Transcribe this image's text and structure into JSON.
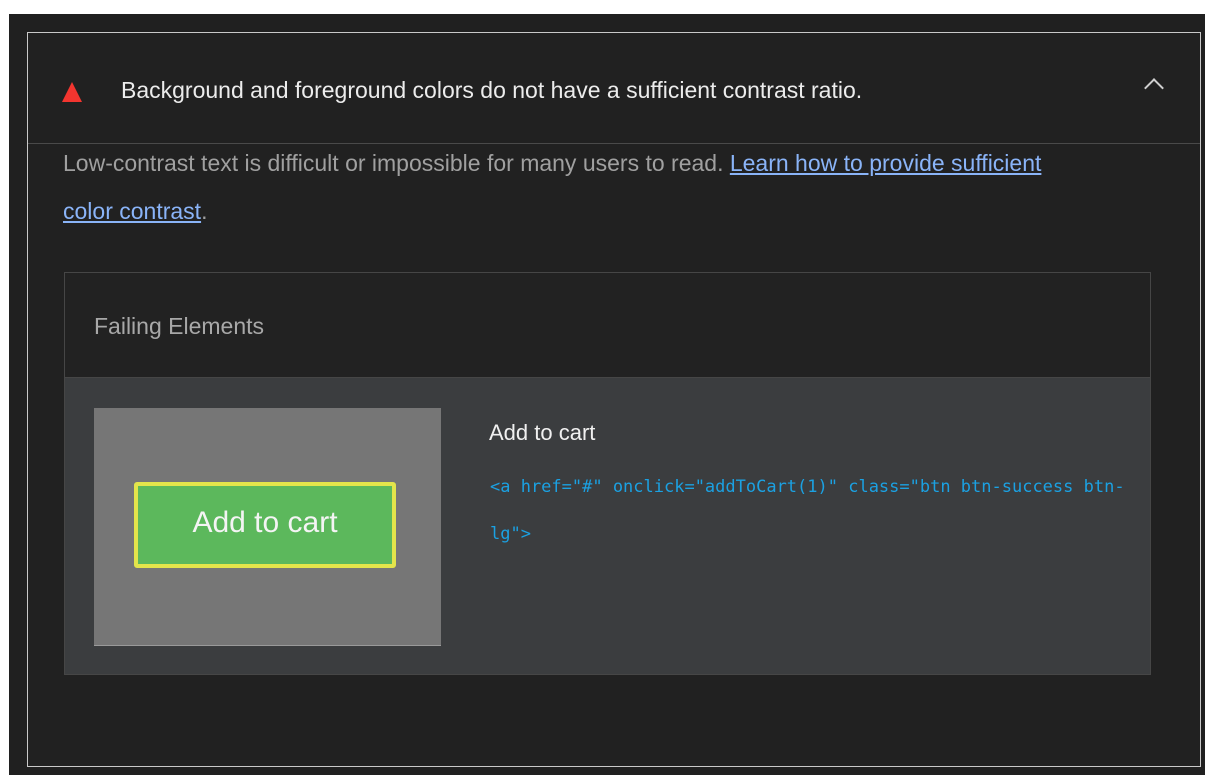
{
  "audit": {
    "title": "Background and foreground colors do not have a sufficient contrast ratio.",
    "status_icon": "warning-triangle-icon",
    "status_color": "#f3352f",
    "expanded_icon": "chevron-up-icon",
    "description_text": "Low-contrast text is difficult or impossible for many users to read. ",
    "learn_more_link": "Learn how to provide sufficient color contrast",
    "description_suffix": "."
  },
  "failing_elements": {
    "title": "Failing Elements",
    "items": [
      {
        "thumbnail_button_text": "Add to cart",
        "snippet_label": "Add to cart",
        "snippet_code": "<a href=\"#\" onclick=\"addToCart(1)\" class=\"btn btn-success btn-lg\">"
      }
    ]
  },
  "colors": {
    "background": "#212121",
    "link": "#8ab4f8",
    "code": "#1ba1e2",
    "highlight_border": "#e3e54b",
    "button_green": "#5cb85c"
  }
}
